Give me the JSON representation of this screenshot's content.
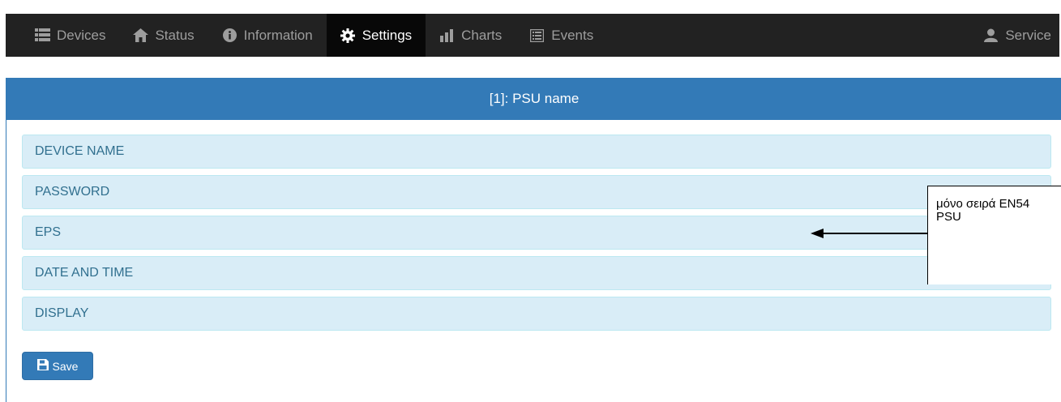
{
  "nav": {
    "items": [
      {
        "label": "Devices",
        "icon": "list-icon"
      },
      {
        "label": "Status",
        "icon": "home-icon"
      },
      {
        "label": "Information",
        "icon": "info-circle-icon"
      },
      {
        "label": "Settings",
        "icon": "gear-icon",
        "active": true
      },
      {
        "label": "Charts",
        "icon": "bar-chart-icon"
      },
      {
        "label": "Events",
        "icon": "list-alt-icon"
      }
    ],
    "user": {
      "label": "Service",
      "icon": "user-icon"
    }
  },
  "panel": {
    "title": "[1]: PSU name",
    "rows": [
      {
        "label": "DEVICE NAME"
      },
      {
        "label": "PASSWORD"
      },
      {
        "label": "EPS"
      },
      {
        "label": "DATE AND TIME"
      },
      {
        "label": "DISPLAY"
      }
    ],
    "save_label": "Save"
  },
  "annotation": {
    "line1": "μόνο σειρά EN54",
    "line2": "PSU"
  },
  "colors": {
    "navbar": "#222222",
    "primary": "#337ab7",
    "row_bg": "#d9edf7",
    "row_text": "#31708f"
  }
}
